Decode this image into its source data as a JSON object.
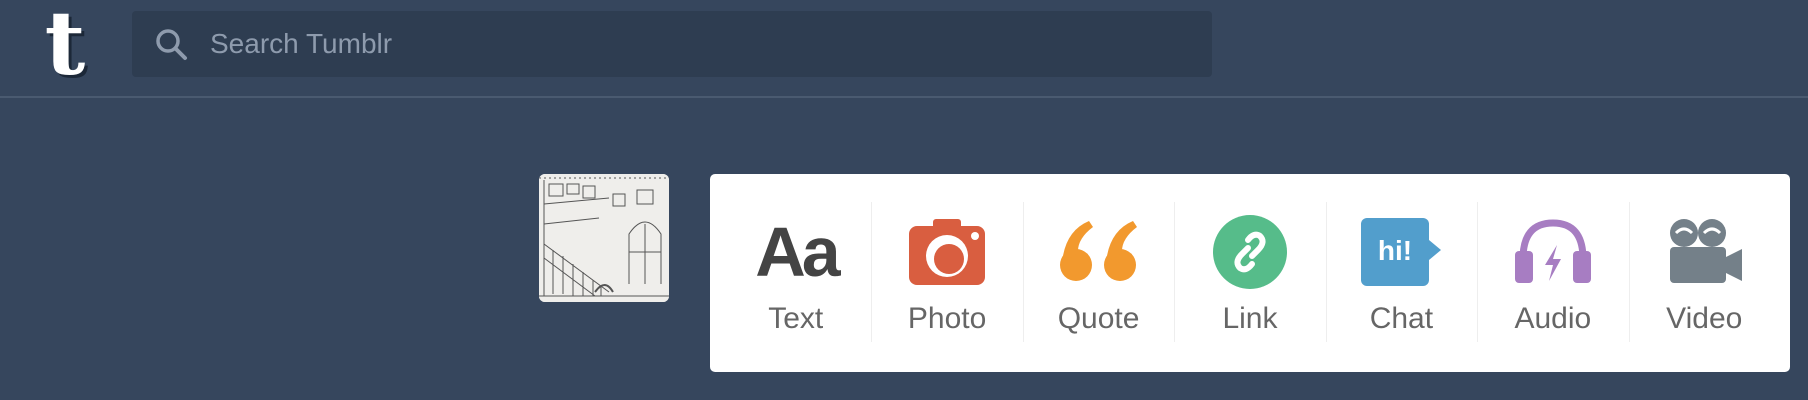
{
  "header": {
    "logo_letter": "t",
    "search": {
      "placeholder": "Search Tumblr",
      "value": ""
    }
  },
  "post_types": [
    {
      "id": "text",
      "label": "Text",
      "icon": "text-aa-icon",
      "glyph": "Aa",
      "color": "#444444"
    },
    {
      "id": "photo",
      "label": "Photo",
      "icon": "camera-icon",
      "color": "#d95e40"
    },
    {
      "id": "quote",
      "label": "Quote",
      "icon": "quote-icon",
      "color": "#f2992e"
    },
    {
      "id": "link",
      "label": "Link",
      "icon": "link-icon",
      "color": "#56bc8a"
    },
    {
      "id": "chat",
      "label": "Chat",
      "icon": "chat-bubble-icon",
      "glyph": "hi!",
      "color": "#529ecc"
    },
    {
      "id": "audio",
      "label": "Audio",
      "icon": "headphones-icon",
      "color": "#a77dc2"
    },
    {
      "id": "video",
      "label": "Video",
      "icon": "video-camera-icon",
      "color": "#748089"
    }
  ],
  "colors": {
    "background": "#36465d",
    "search_bg": "#2e3d51",
    "panel_bg": "#ffffff"
  }
}
